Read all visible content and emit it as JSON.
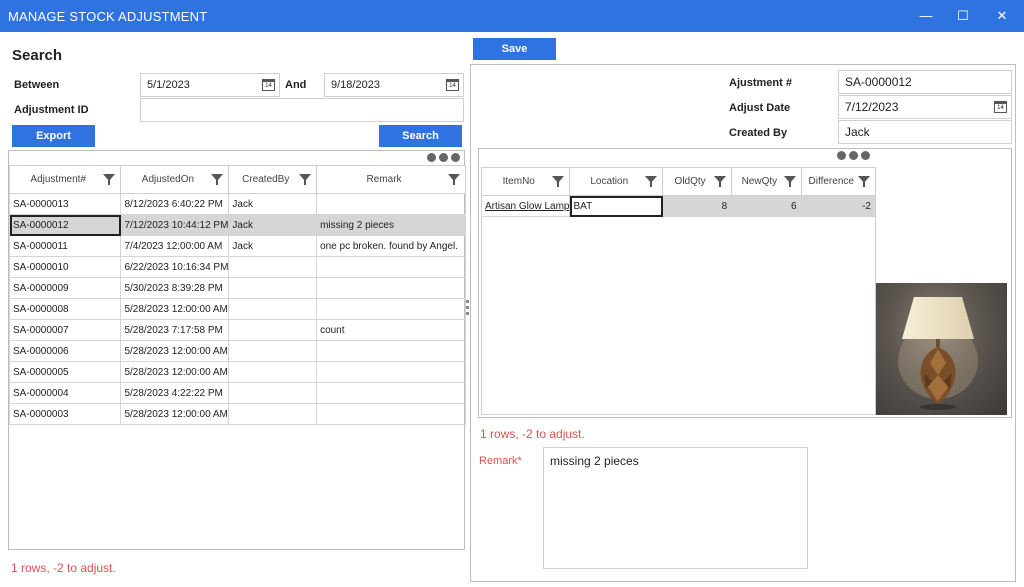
{
  "window": {
    "title": "MANAGE STOCK ADJUSTMENT",
    "minimize_glyph": "—",
    "maximize_glyph": "☐",
    "close_glyph": "✕"
  },
  "search": {
    "heading": "Search",
    "between_label": "Between",
    "from_date": "5/1/2023",
    "and_label": "And",
    "to_date": "9/18/2023",
    "adjustment_id_label": "Adjustment ID",
    "adjustment_id_value": "",
    "export_label": "Export",
    "search_label": "Search",
    "calendar_glyph": "14"
  },
  "list": {
    "columns": [
      "Adjustment#",
      "AdjustedOn",
      "CreatedBy",
      "Remark"
    ],
    "rows": [
      [
        "SA-0000013",
        "8/12/2023 6:40:22 PM",
        "Jack",
        ""
      ],
      [
        "SA-0000012",
        "7/12/2023 10:44:12 PM",
        "Jack",
        "missing 2 pieces"
      ],
      [
        "SA-0000011",
        "7/4/2023 12:00:00 AM",
        "Jack",
        "one pc broken.  found by Angel."
      ],
      [
        "SA-0000010",
        "6/22/2023 10:16:34 PM",
        "",
        ""
      ],
      [
        "SA-0000009",
        "5/30/2023 8:39:28 PM",
        "",
        ""
      ],
      [
        "SA-0000008",
        "5/28/2023 12:00:00 AM",
        "",
        ""
      ],
      [
        "SA-0000007",
        "5/28/2023 7:17:58 PM",
        "",
        "count"
      ],
      [
        "SA-0000006",
        "5/28/2023 12:00:00 AM",
        "",
        ""
      ],
      [
        "SA-0000005",
        "5/28/2023 12:00:00 AM",
        "",
        ""
      ],
      [
        "SA-0000004",
        "5/28/2023 4:22:22 PM",
        "",
        ""
      ],
      [
        "SA-0000003",
        "5/28/2023 12:00:00 AM",
        "",
        ""
      ]
    ],
    "selected_row": 1,
    "status": "1 rows, -2 to adjust."
  },
  "detail": {
    "save_label": "Save",
    "adjustment_no_label": "Ajustment #",
    "adjustment_no": "SA-0000012",
    "adjust_date_label": "Adjust Date",
    "adjust_date": "7/12/2023",
    "created_by_label": "Created By",
    "created_by": "Jack",
    "columns": [
      "ItemNo",
      "Location",
      "OldQty",
      "NewQty",
      "Difference"
    ],
    "rows": [
      [
        "Artisan Glow Lamp",
        "BAT",
        "8",
        "6",
        "-2"
      ]
    ],
    "status": "1 rows, -2 to adjust.",
    "remark_label": "Remark*",
    "remark_value": "missing 2 pieces"
  },
  "colors": {
    "accent": "#2f73e0",
    "status_red": "#d9534f",
    "selected_row": "#d6d6d6"
  }
}
